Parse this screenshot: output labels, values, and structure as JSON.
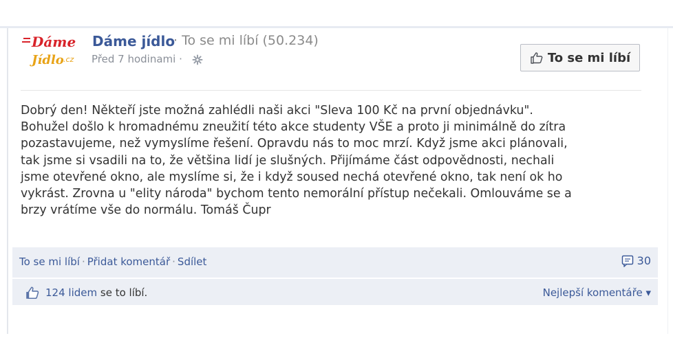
{
  "post": {
    "page_name": "Dáme jídlo",
    "likes_meta": "· To se mi líbí (50.234)",
    "timestamp": "Před 7 hodinami ·",
    "like_page_label": "To se mi líbí",
    "text": "Dobrý den! Někteří jste možná zahlédli naši akci \"Sleva 100 Kč na první objednávku\".\nBohužel došlo k hromadnému zneužití této akce studenty VŠE a proto ji minimálně do zítra\npozastavujeme, než vymyslíme řešení. Opravdu nás to moc mrzí. Když jsme akci plánovali,\ntak jsme si vsadili na to, že většina lidí je slušných. Přijímáme část odpovědnosti, nechali\njsme otevřené okno, ale myslíme si, že i když soused nechá otevřené okno, tak není ok ho\nvykrást. Zrovna u \"elity národa\" bychom tento nemorální přístup nečekali. Omlouváme se a\nbrzy vrátíme vše do normálu. Tomáš Čupr"
  },
  "logo": {
    "line1": "Dáme",
    "line2": "Jídlo",
    "suffix": ".cz",
    "icons": [
      "logo-icon"
    ],
    "colors": {
      "red": "#d8232a",
      "yellow": "#e8a317"
    }
  },
  "actions": {
    "like": "To se mi líbí",
    "comment": "Přidat komentář",
    "share": "Sdílet",
    "separator": "·",
    "comment_count": "30"
  },
  "likes": {
    "count": "124 lidem",
    "suffix": "se to líbí.",
    "best_comments": "Nejlepší komentáře ▾"
  },
  "colors": {
    "link": "#3b5998",
    "bar": "#eceff5",
    "text": "#333333"
  }
}
